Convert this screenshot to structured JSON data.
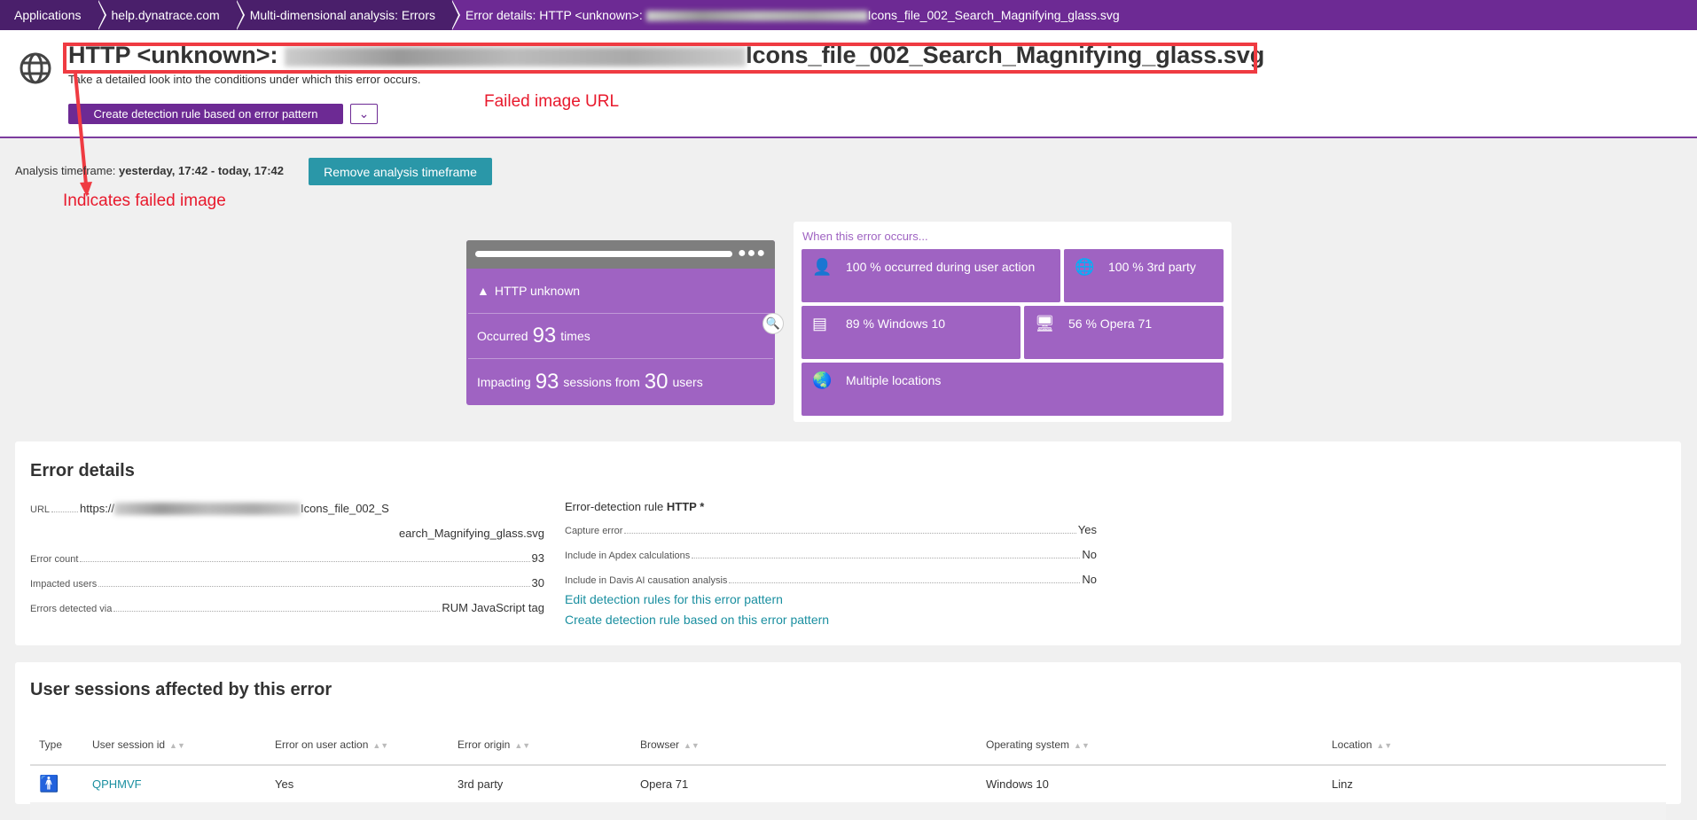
{
  "breadcrumb": [
    "Applications",
    "help.dynatrace.com",
    "Multi-dimensional analysis: Errors",
    "Error details: HTTP <unknown>:"
  ],
  "breadcrumb_tail": "Icons_file_002_Search_Magnifying_glass.svg",
  "header": {
    "title_prefix": "HTTP <unknown>:",
    "title_suffix": "Icons_file_002_Search_Magnifying_glass.svg",
    "subtitle": "Take a detailed look into the conditions under which this error occurs.",
    "create_button": "Create detection rule based on error pattern"
  },
  "annotations": {
    "failed_url": "Failed image URL",
    "indicates": "Indicates failed image"
  },
  "timeframe": {
    "label": "Analysis timeframe:",
    "value": "yesterday, 17:42 - today, 17:42",
    "remove_button": "Remove analysis timeframe"
  },
  "summary": {
    "error_name": "HTTP unknown",
    "occurred_pre": "Occurred",
    "occurred_count": "93",
    "occurred_post": "times",
    "impact_pre": "Impacting",
    "sessions": "93",
    "impact_mid": "sessions from",
    "users": "30",
    "impact_post": "users"
  },
  "occurs": {
    "heading": "When this error occurs...",
    "tiles": [
      "100 % occurred during user action",
      "100 % 3rd party",
      "89 % Windows 10",
      "56 % Opera 71",
      "Multiple locations"
    ]
  },
  "error_details": {
    "heading": "Error details",
    "url_label": "URL",
    "url_prefix": "https://",
    "url_suffix1": "Icons_file_002_S",
    "url_suffix2": "earch_Magnifying_glass.svg",
    "rows": [
      {
        "label": "Error count",
        "value": "93"
      },
      {
        "label": "Impacted users",
        "value": "30"
      },
      {
        "label": "Errors detected via",
        "value": "RUM JavaScript tag"
      }
    ],
    "rule_label": "Error-detection rule",
    "rule_name": "HTTP *",
    "rule_rows": [
      {
        "label": "Capture error",
        "value": "Yes"
      },
      {
        "label": "Include in Apdex calculations",
        "value": "No"
      },
      {
        "label": "Include in Davis AI causation analysis",
        "value": "No"
      }
    ],
    "links": [
      "Edit detection rules for this error pattern",
      "Create detection rule based on this error pattern"
    ]
  },
  "sessions": {
    "heading": "User sessions affected by this error",
    "columns": [
      "Type",
      "User session id",
      "Error on user action",
      "Error origin",
      "Browser",
      "Operating system",
      "Location"
    ],
    "rows": [
      {
        "id": "QPHMVF",
        "user_action": "Yes",
        "origin": "3rd party",
        "browser": "Opera 71",
        "os": "Windows 10",
        "location": "Linz"
      }
    ]
  }
}
